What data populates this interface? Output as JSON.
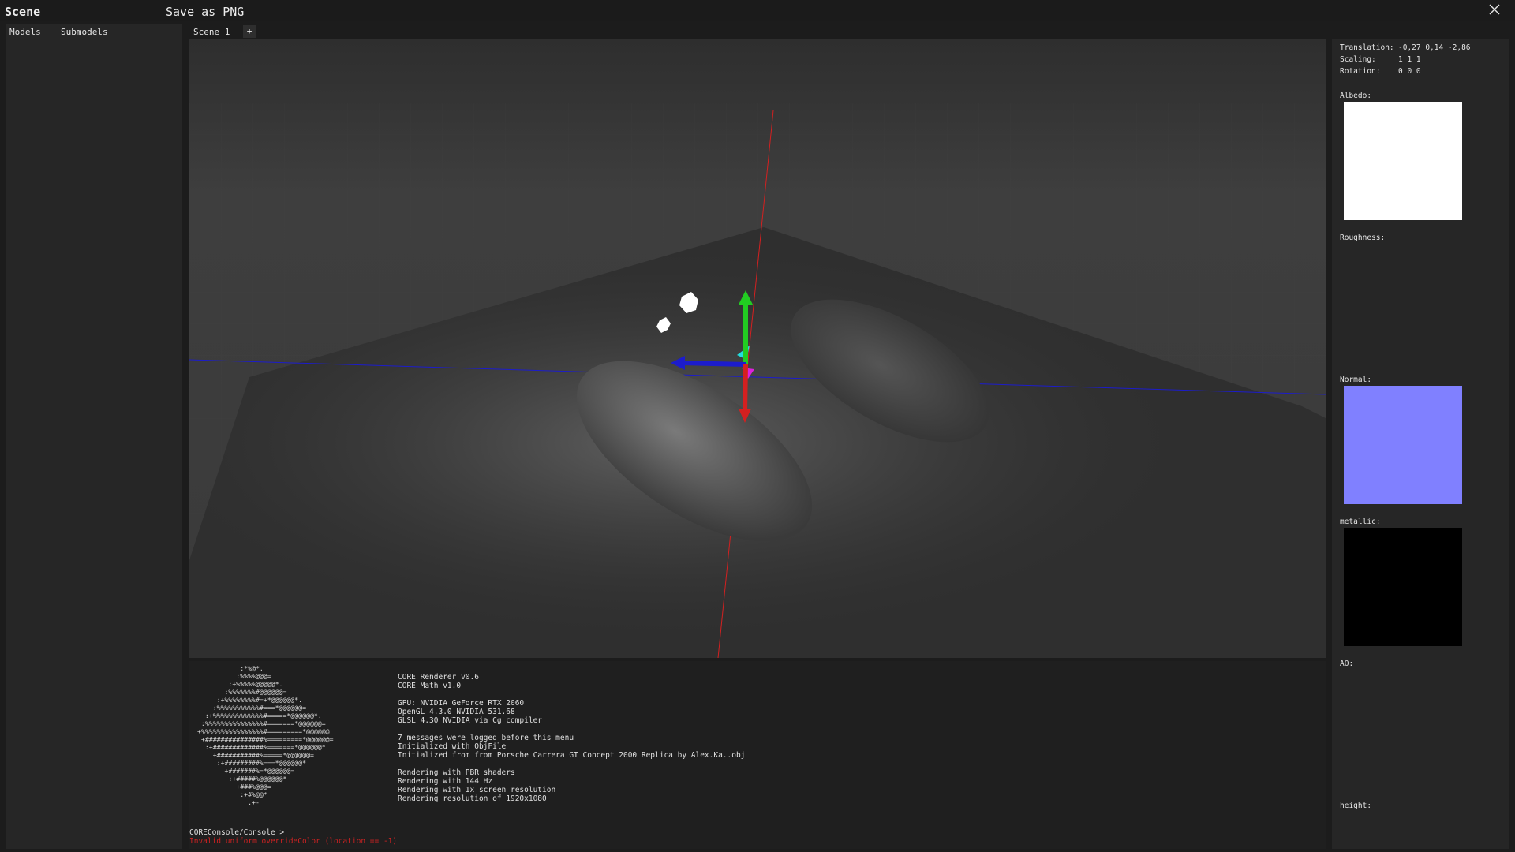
{
  "window": {
    "title": "Scene",
    "save_label": "Save as PNG"
  },
  "left_panel": {
    "tabs": [
      "Models",
      "Submodels"
    ]
  },
  "scene_tabs": {
    "active": "Scene 1",
    "add_label": "+"
  },
  "properties": {
    "translation_label": "Translation:",
    "translation_value": "-0,27 0,14 -2,86",
    "scaling_label": "Scaling:",
    "scaling_value": "1 1 1",
    "rotation_label": "Rotation:",
    "rotation_value": "0 0 0"
  },
  "materials": {
    "albedo_label": "Albedo:",
    "albedo_color": "#ffffff",
    "roughness_label": "Roughness:",
    "normal_label": "Normal:",
    "normal_color": "#8080ff",
    "metallic_label": "metallic:",
    "metallic_color": "#000000",
    "ao_label": "AO:",
    "height_label": "height:"
  },
  "console": {
    "ascii_logo": "           :*%@*.\n          :%%%%@@@=\n        :+%%%%%@@@@@*.\n       :%%%%%%%#@@@@@@=\n     :+%%%%%%%%#=+*@@@@@@*.\n    :%%%%%%%%%%%#===*@@@@@@=\n  :+%%%%%%%%%%%%%#=====*@@@@@@*.\n :%%%%%%%%%%%%%%%#=======*@@@@@@=\n+%%%%%%%%%%%%%%%%#=========*@@@@@@\n +###############%=========*@@@@@@=\n  :+#############%=======*@@@@@@*\n    +###########%=====*@@@@@@=\n     :+#########%===*@@@@@@*\n       +#######%=*@@@@@@=\n        :+#####%@@@@@@*\n          +###%@@@=\n           :+#%@@*\n             .+-",
    "header_lines": [
      "CORE Renderer v0.6",
      "CORE Math v1.0"
    ],
    "gpu_lines": [
      "GPU: NVIDIA GeForce RTX 2060",
      "OpenGL 4.3.0 NVIDIA 531.68",
      "GLSL 4.30 NVIDIA via Cg compiler"
    ],
    "message_lines": [
      "7 messages were logged before this menu",
      "Initialized with ObjFile",
      "Initialized from from Porsche Carrera GT Concept 2000 Replica by Alex.Ka..obj"
    ],
    "render_lines": [
      "Rendering with PBR shaders",
      "Rendering with 144 Hz",
      "Rendering with 1x screen resolution",
      "Rendering resolution of 1920x1080"
    ],
    "prompt": "COREConsole/Console >",
    "error": "Invalid uniform overrideColor (location == -1)"
  },
  "colors": {
    "viewport_bg": "#3a3a3a",
    "floor": "#2f2f2f",
    "axis_red": "#d42020",
    "axis_green": "#22cc22",
    "axis_blue": "#1c1ccc",
    "error_text": "#cc2222"
  },
  "icons": {
    "close": "close-icon"
  }
}
